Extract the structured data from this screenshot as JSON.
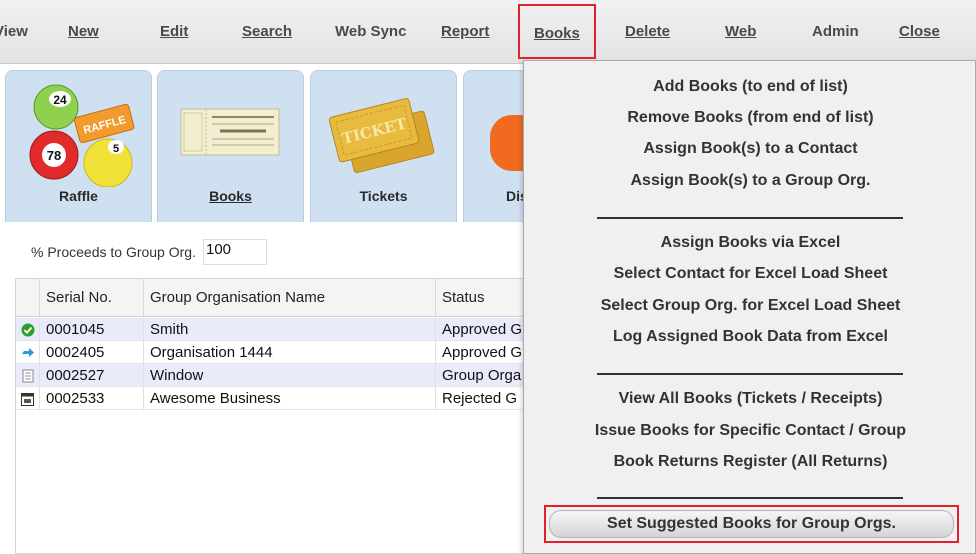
{
  "menu": {
    "items": [
      {
        "label": "View",
        "name": "menu-view"
      },
      {
        "label": "New",
        "name": "menu-new"
      },
      {
        "label": "Edit",
        "name": "menu-edit"
      },
      {
        "label": "Search",
        "name": "menu-search"
      },
      {
        "label": "Web Sync",
        "name": "menu-web-sync"
      },
      {
        "label": "Report",
        "name": "menu-report"
      },
      {
        "label": "Books",
        "name": "menu-books"
      },
      {
        "label": "Delete",
        "name": "menu-delete"
      },
      {
        "label": "Web",
        "name": "menu-web"
      },
      {
        "label": "Admin",
        "name": "menu-admin"
      },
      {
        "label": "Close",
        "name": "menu-close"
      }
    ]
  },
  "tiles": [
    {
      "label": "Raffle"
    },
    {
      "label": "Books"
    },
    {
      "label": "Tickets"
    },
    {
      "label": "Dis"
    }
  ],
  "raffle_badges": {
    "ball_top": "24",
    "tag": "RAFFLE",
    "ball_red": "78",
    "ball_yellow": "5"
  },
  "ticket_text": "TICKET",
  "proceeds": {
    "label": "% Proceeds to Group Org.",
    "value": "100"
  },
  "grid": {
    "columns": [
      "Serial No.",
      "Group Organisation Name",
      "Status"
    ],
    "rows": [
      {
        "serial": "0001045",
        "name": "Smith",
        "status": "Approved G",
        "icon": "check-icon"
      },
      {
        "serial": "0002405",
        "name": "Organisation 1444",
        "status": "Approved G",
        "icon": "arrow-right-icon"
      },
      {
        "serial": "0002527",
        "name": "Window",
        "status": "Group Orga",
        "icon": "document-icon"
      },
      {
        "serial": "0002533",
        "name": "Awesome Business",
        "status": "Rejected G",
        "icon": "calendar-icon"
      }
    ]
  },
  "dropdown": {
    "group1": [
      "Add Books (to end of list)",
      "Remove Books (from end of list)",
      "Assign Book(s) to a Contact",
      "Assign Book(s) to a Group Org."
    ],
    "group2": [
      "Assign Books via Excel",
      "Select Contact for Excel Load Sheet",
      "Select Group Org. for Excel Load Sheet",
      "Log Assigned Book Data from Excel"
    ],
    "group3": [
      "View All Books (Tickets / Receipts)",
      "Issue Books for Specific Contact / Group",
      "Book Returns Register (All Returns)"
    ],
    "highlighted": "Set Suggested Books for Group Orgs."
  },
  "colors": {
    "highlight_border": "#e0212b",
    "tile_bg": "#cfe0f0",
    "alt_row": "#e9ebfb"
  }
}
